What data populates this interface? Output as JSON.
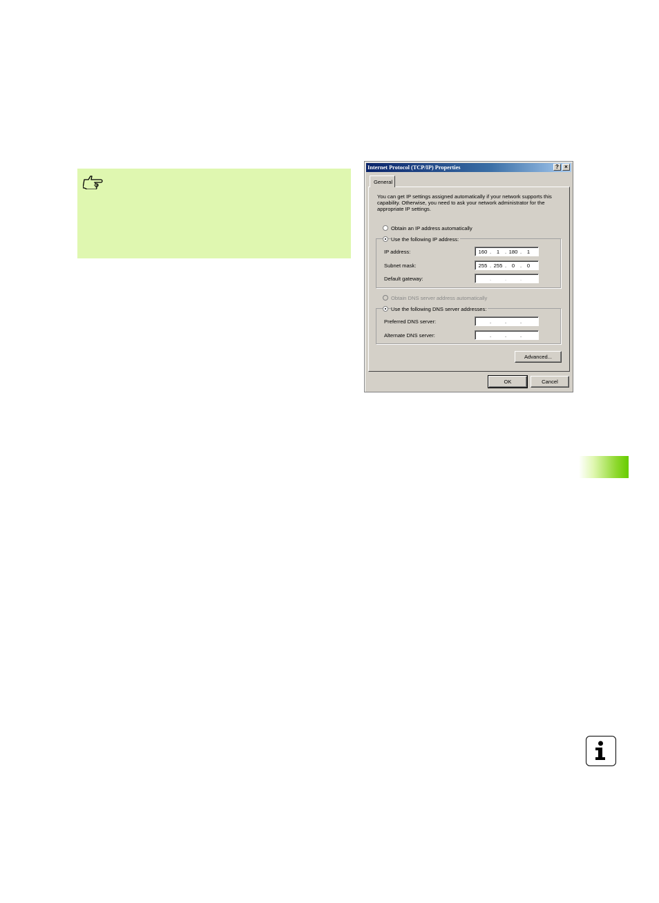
{
  "note": {
    "icon": "pointing-hand-icon"
  },
  "dialog": {
    "title": "Internet Protocol (TCP/IP) Properties",
    "help_label": "?",
    "close_label": "×",
    "tab_label": "General",
    "intro_text": "You can get IP settings assigned automatically if your network supports this capability. Otherwise, you need to ask your network administrator for the appropriate IP settings.",
    "ip": {
      "auto_label": "Obtain an IP address automatically",
      "manual_label": "Use the following IP address:",
      "selected": "manual",
      "address_label": "IP address:",
      "address_octets": [
        "160",
        "1",
        "180",
        "1"
      ],
      "subnet_label": "Subnet mask:",
      "subnet_octets": [
        "255",
        "255",
        "0",
        "0"
      ],
      "gateway_label": "Default gateway:",
      "gateway_octets": [
        "",
        "",
        "",
        ""
      ]
    },
    "dns": {
      "auto_label": "Obtain DNS server address automatically",
      "manual_label": "Use the following DNS server addresses:",
      "selected": "manual",
      "preferred_label": "Preferred DNS server:",
      "preferred_octets": [
        "",
        "",
        "",
        ""
      ],
      "alternate_label": "Alternate DNS server:",
      "alternate_octets": [
        "",
        "",
        "",
        ""
      ]
    },
    "advanced_label": "Advanced...",
    "ok_label": "OK",
    "cancel_label": "Cancel"
  },
  "side": {
    "info_icon": "info-icon",
    "info_glyph": "i"
  }
}
